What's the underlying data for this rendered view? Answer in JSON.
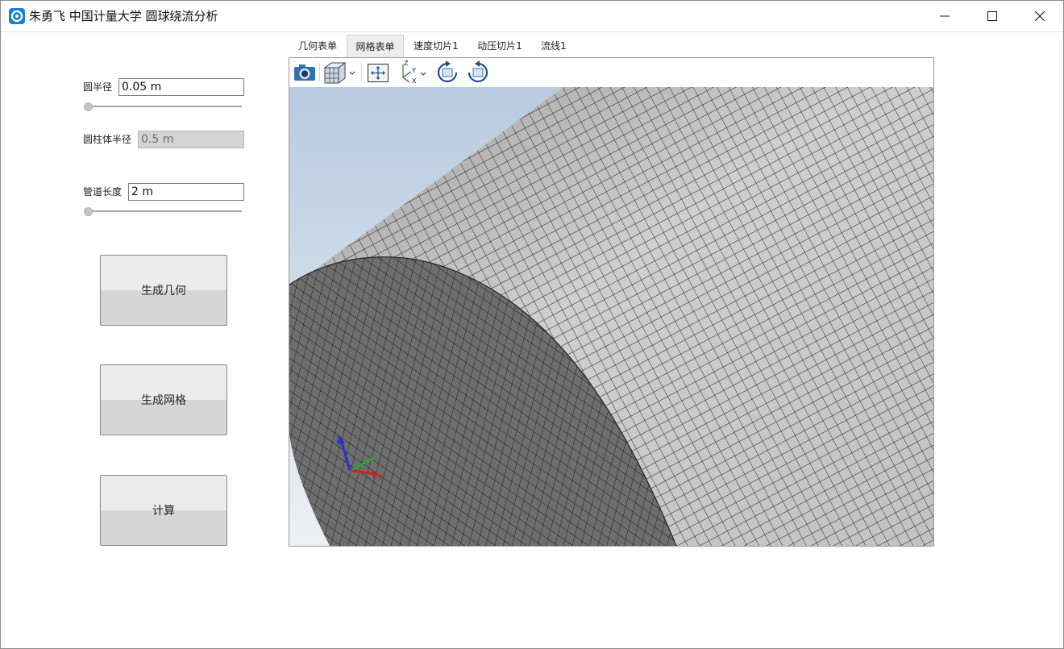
{
  "window": {
    "title": "朱勇飞 中国计量大学 圆球绕流分析"
  },
  "icons": {
    "app": "app-logo-icon",
    "minimize": "minimize-icon",
    "maximize": "maximize-icon",
    "close": "close-icon"
  },
  "form": {
    "sphere_radius": {
      "label": "圆半径",
      "value": "0.05 m",
      "slider_fraction": 0.0
    },
    "cylinder_radius": {
      "label": "圆柱体半径",
      "value": "0.5 m",
      "disabled": true
    },
    "pipe_length": {
      "label": "管道长度",
      "value": "2 m",
      "slider_fraction": 0.0
    }
  },
  "buttons": {
    "generate_geometry": "生成几何",
    "generate_mesh": "生成网格",
    "compute": "计算"
  },
  "tabs": [
    {
      "label": "几何表单",
      "active": false
    },
    {
      "label": "网格表单",
      "active": true
    },
    {
      "label": "速度切片1",
      "active": false
    },
    {
      "label": "动压切片1",
      "active": false
    },
    {
      "label": "流线1",
      "active": false
    }
  ],
  "toolbar": {
    "items": [
      "camera-icon",
      "view-cube-icon",
      "zoom-extents-icon",
      "axis-orientation-icon",
      "rotate-cw-icon",
      "rotate-ccw-icon"
    ]
  },
  "viewport": {
    "axis_labels": {
      "x": "X",
      "y": "Y",
      "z": "Z"
    },
    "colors": {
      "background_top": "#b8cbe0",
      "background_bottom": "#eef0f3",
      "mesh_line": "#111111"
    }
  }
}
